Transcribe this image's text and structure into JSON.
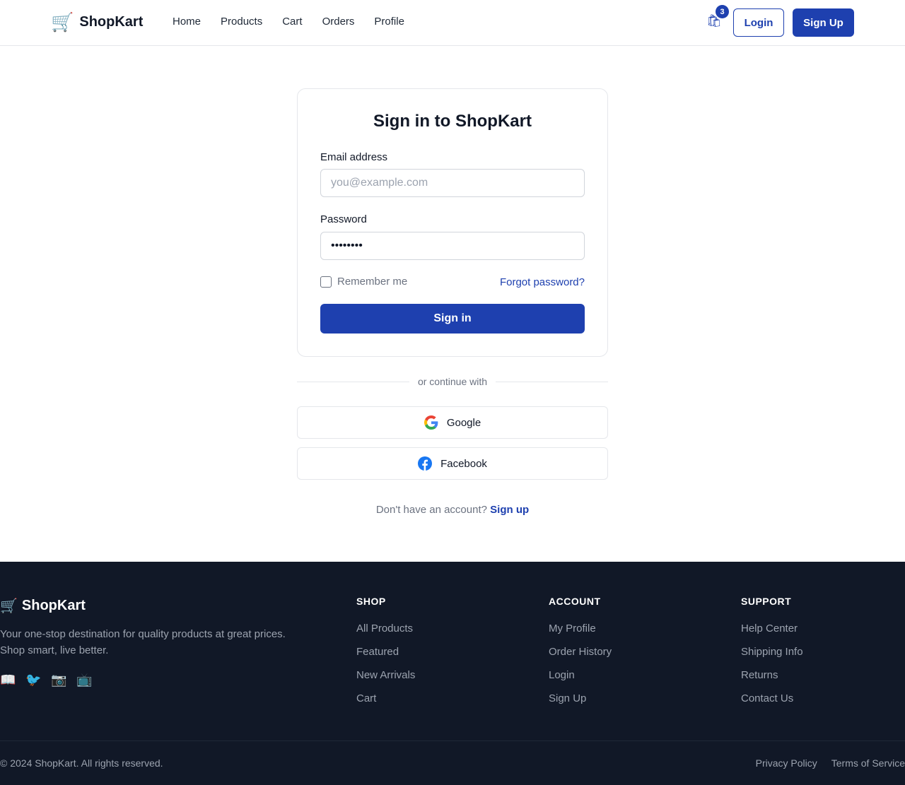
{
  "header": {
    "brand": "ShopKart",
    "nav": [
      "Home",
      "Products",
      "Cart",
      "Orders",
      "Profile"
    ],
    "cart_badge": "3",
    "login_label": "Login",
    "signup_label": "Sign Up"
  },
  "login_card": {
    "title": "Sign in to ShopKart",
    "email_label": "Email address",
    "email_placeholder": "you@example.com",
    "email_value": "",
    "password_label": "Password",
    "password_value": "••••••••",
    "remember_label": "Remember me",
    "remember_checked": false,
    "forgot_label": "Forgot password?",
    "submit_label": "Sign in"
  },
  "divider_text": "or continue with",
  "social": {
    "google_label": "Google",
    "facebook_label": "Facebook"
  },
  "signup_prompt": {
    "text": "Don't have an account?",
    "link": "Sign up"
  },
  "footer": {
    "brand": "ShopKart",
    "description": "Your one-stop destination for quality products at great prices. Shop smart, live better.",
    "social_icons": [
      "📖",
      "🐦",
      "📷",
      "📺"
    ],
    "columns": [
      {
        "title": "SHOP",
        "links": [
          "All Products",
          "Featured",
          "New Arrivals",
          "Cart"
        ]
      },
      {
        "title": "ACCOUNT",
        "links": [
          "My Profile",
          "Order History",
          "Login",
          "Sign Up"
        ]
      },
      {
        "title": "SUPPORT",
        "links": [
          "Help Center",
          "Shipping Info",
          "Returns",
          "Contact Us"
        ]
      }
    ],
    "copyright": "© 2024 ShopKart. All rights reserved.",
    "bottom_links": [
      "Privacy Policy",
      "Terms of Service"
    ]
  },
  "colors": {
    "primary": "#1e40af",
    "footer_bg": "#111827",
    "border": "#e5e7eb"
  }
}
